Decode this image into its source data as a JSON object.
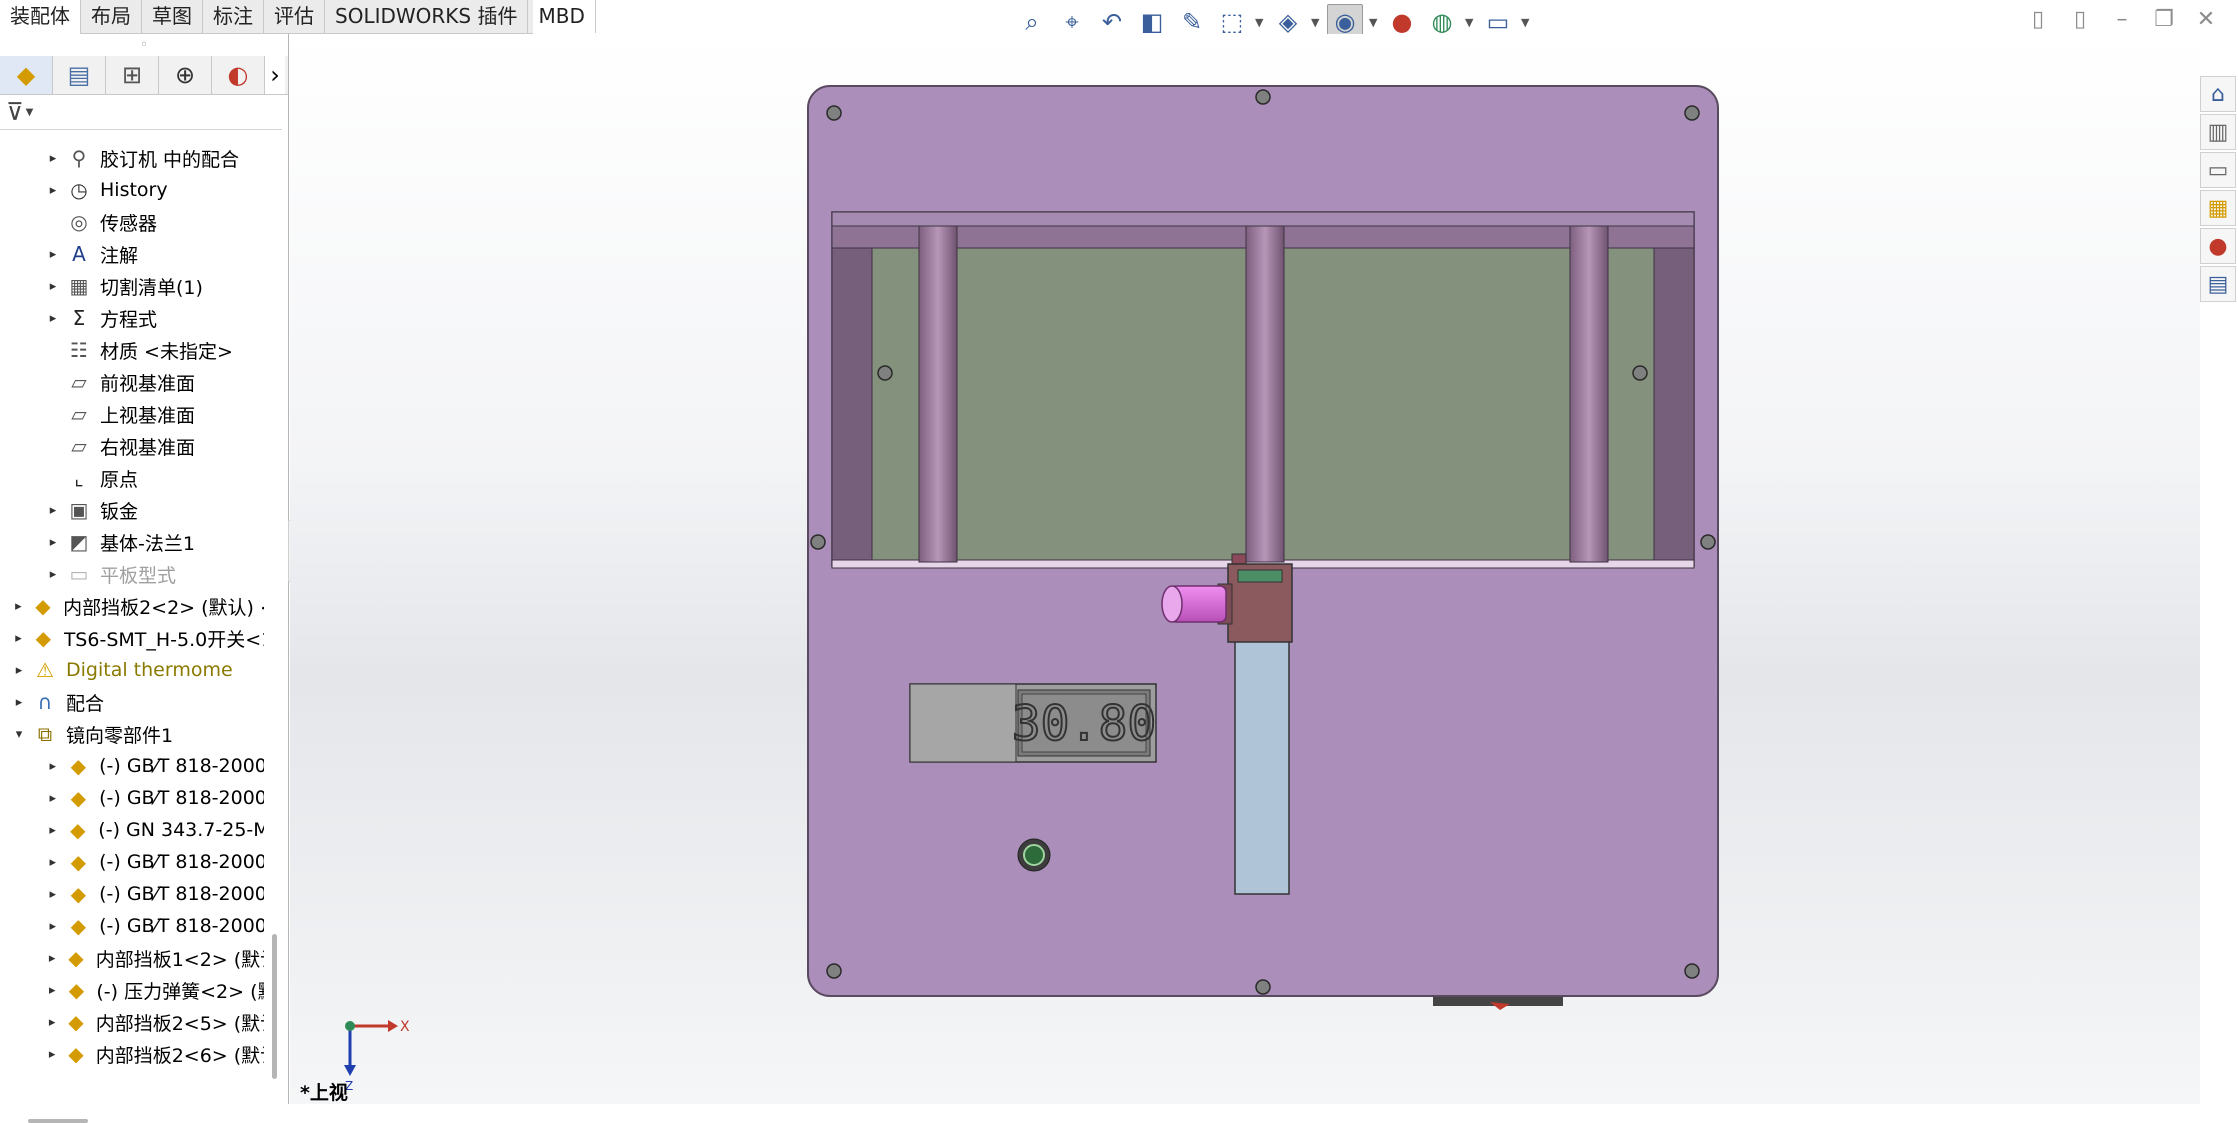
{
  "tabs": [
    "装配体",
    "布局",
    "草图",
    "标注",
    "评估",
    "SOLIDWORKS 插件",
    "MBD"
  ],
  "hud_icons": [
    "zoom-to-fit-icon",
    "zoom-area-icon",
    "previous-view-icon",
    "section-view-icon",
    "dynamic-annotation-icon",
    "view-orientation-icon",
    "display-style-icon",
    "hide-show-items-icon",
    "edit-appearance-icon",
    "apply-scene-icon",
    "view-settings-icon"
  ],
  "feature_tree": [
    {
      "label": "胶订机 中的配合",
      "icon": "mates-folder-icon",
      "level": 1,
      "arrow": true
    },
    {
      "label": "History",
      "icon": "history-icon",
      "level": 1,
      "arrow": true
    },
    {
      "label": "传感器",
      "icon": "sensor-icon",
      "level": 1,
      "arrow": false
    },
    {
      "label": "注解",
      "icon": "annotations-icon",
      "level": 1,
      "arrow": true
    },
    {
      "label": "切割清单(1)",
      "icon": "cut-list-icon",
      "level": 1,
      "arrow": true
    },
    {
      "label": "方程式",
      "icon": "equations-icon",
      "level": 1,
      "arrow": true
    },
    {
      "label": "材质 <未指定>",
      "icon": "material-icon",
      "level": 1,
      "arrow": false
    },
    {
      "label": "前视基准面",
      "icon": "plane-icon",
      "level": 1,
      "arrow": false
    },
    {
      "label": "上视基准面",
      "icon": "plane-icon",
      "level": 1,
      "arrow": false
    },
    {
      "label": "右视基准面",
      "icon": "plane-icon",
      "level": 1,
      "arrow": false
    },
    {
      "label": "原点",
      "icon": "origin-icon",
      "level": 1,
      "arrow": false
    },
    {
      "label": "钣金",
      "icon": "sheet-metal-icon",
      "level": 1,
      "arrow": true
    },
    {
      "label": "基体-法兰1",
      "icon": "base-flange-icon",
      "level": 1,
      "arrow": true
    },
    {
      "label": "平板型式",
      "icon": "flat-pattern-icon",
      "level": 1,
      "arrow": true,
      "muted": true
    },
    {
      "label": "内部挡板2<2> (默认) <",
      "icon": "part-icon",
      "level": 0,
      "arrow": true
    },
    {
      "label": "TS6-SMT_H-5.0开关<1",
      "icon": "part-icon",
      "level": 0,
      "arrow": true
    },
    {
      "label": "Digital thermome",
      "icon": "warning-icon",
      "level": 0,
      "arrow": true,
      "warn": true
    },
    {
      "label": "配合",
      "icon": "mates-icon",
      "level": 0,
      "arrow": true
    },
    {
      "label": "镜向零部件1",
      "icon": "mirror-component-icon",
      "level": 0,
      "arrow": true,
      "expanded": true
    },
    {
      "label": "(-) GB⁄T 818-2000",
      "icon": "part-icon",
      "level": 1,
      "arrow": true
    },
    {
      "label": "(-) GB⁄T 818-2000",
      "icon": "part-icon",
      "level": 1,
      "arrow": true
    },
    {
      "label": "(-) GN 343.7-25-M",
      "icon": "part-icon",
      "level": 1,
      "arrow": true
    },
    {
      "label": "(-) GB⁄T 818-2000",
      "icon": "part-icon",
      "level": 1,
      "arrow": true
    },
    {
      "label": "(-) GB⁄T 818-2000",
      "icon": "part-icon",
      "level": 1,
      "arrow": true
    },
    {
      "label": "(-) GB⁄T 818-2000",
      "icon": "part-icon",
      "level": 1,
      "arrow": true
    },
    {
      "label": "内部挡板1<2> (默认",
      "icon": "part-icon",
      "level": 1,
      "arrow": true
    },
    {
      "label": "(-) 压力弹簧<2> (默",
      "icon": "part-icon",
      "level": 1,
      "arrow": true
    },
    {
      "label": "内部挡板2<5> (默认",
      "icon": "part-icon",
      "level": 1,
      "arrow": true
    },
    {
      "label": "内部挡板2<6> (默认",
      "icon": "part-icon",
      "level": 1,
      "arrow": true
    }
  ],
  "model": {
    "display_value": "30.80",
    "plate_color": "#ab8fba",
    "glass_color": "#84917d",
    "bar_color": "#b0c4d8"
  },
  "triad": {
    "x_label": "X",
    "z_label": "Z"
  },
  "view_name": "*上视",
  "taskpane_icons": [
    "home-icon",
    "design-library-icon",
    "file-explorer-icon",
    "view-palette-icon",
    "appearances-icon",
    "custom-properties-icon"
  ]
}
